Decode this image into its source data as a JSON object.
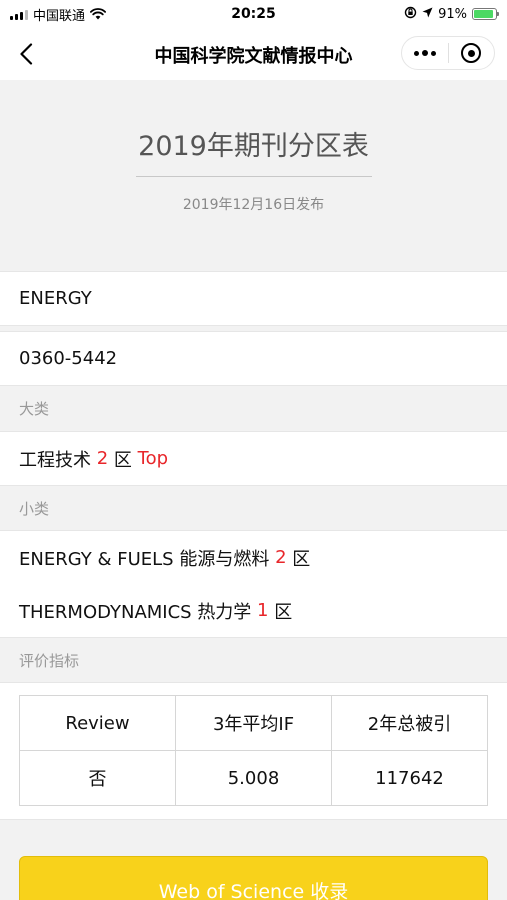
{
  "status_bar": {
    "carrier": "中国联通",
    "time": "20:25",
    "battery_percent": "91%",
    "battery_level": 0.91
  },
  "nav": {
    "title": "中国科学院文献情报中心",
    "back_icon": "chevron-left-icon",
    "more_icon": "more-dots-icon",
    "close_icon": "close-circle-icon"
  },
  "header": {
    "title": "2019年期刊分区表",
    "publish_date": "2019年12月16日发布"
  },
  "journal": {
    "name": "ENERGY",
    "issn": "0360-5442"
  },
  "major_category": {
    "label": "大类",
    "name": "工程技术",
    "zone": "2",
    "zone_suffix": "区",
    "top": "Top"
  },
  "minor_category": {
    "label": "小类",
    "items": [
      {
        "name": "ENERGY & FUELS 能源与燃料",
        "zone": "2",
        "zone_suffix": "区"
      },
      {
        "name": "THERMODYNAMICS 热力学",
        "zone": "1",
        "zone_suffix": "区"
      }
    ]
  },
  "metrics": {
    "label": "评价指标",
    "headers": [
      "Review",
      "3年平均IF",
      "2年总被引"
    ],
    "values": [
      "否",
      "5.008",
      "117642"
    ]
  },
  "wos_button": {
    "label": "Web of Science 收录"
  },
  "colors": {
    "accent_red": "#e8262a",
    "button_yellow": "#f8d21b",
    "battery_green": "#4cd964"
  }
}
